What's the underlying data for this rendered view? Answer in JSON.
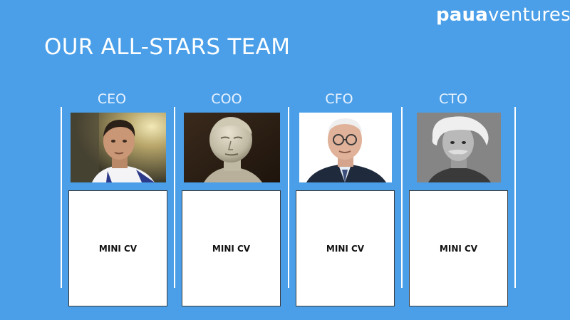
{
  "logo": {
    "part_bold": "paua",
    "part_light": "ventures"
  },
  "title": "OUR ALL-STARS TEAM",
  "members": [
    {
      "role": "CEO",
      "cv_label": "MINI CV"
    },
    {
      "role": "COO",
      "cv_label": "MINI CV"
    },
    {
      "role": "CFO",
      "cv_label": "MINI CV"
    },
    {
      "role": "CTO",
      "cv_label": "MINI CV"
    }
  ],
  "colors": {
    "background": "#4a9fe8",
    "text": "#ffffff"
  }
}
